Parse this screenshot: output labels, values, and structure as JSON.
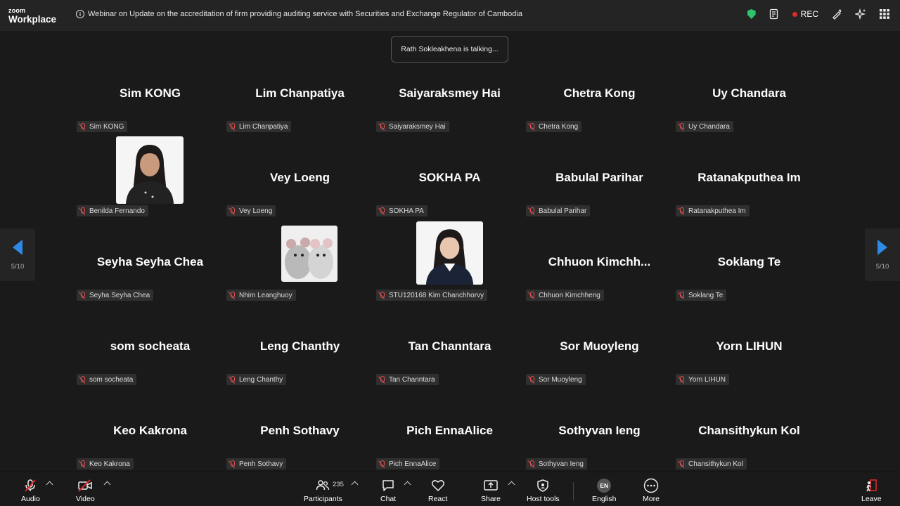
{
  "app": {
    "logo_top": "zoom",
    "logo_bottom": "Workplace"
  },
  "meeting": {
    "title": "Webinar on Update on the accreditation of firm providing auditing service with Securities and Exchange Regulator of Cambodia"
  },
  "topbar": {
    "rec_label": "REC",
    "rec_color": "#e02828",
    "shield_color": "#2dc26b"
  },
  "toast": {
    "text": "Rath Sokleakhena is talking..."
  },
  "pager": {
    "left": "5/10",
    "right": "5/10",
    "arrow_color": "#2e8ae6"
  },
  "participants": [
    {
      "display": "Sim KONG",
      "tag": "Sim KONG"
    },
    {
      "display": "Lim Chanpatiya",
      "tag": "Lim Chanpatiya"
    },
    {
      "display": "Saiyaraksmey Hai",
      "tag": "Saiyaraksmey Hai"
    },
    {
      "display": "Chetra Kong",
      "tag": "Chetra Kong"
    },
    {
      "display": "Uy Chandara",
      "tag": "Uy Chandara"
    },
    {
      "display": "",
      "tag": "Benilda Fernando"
    },
    {
      "display": "Vey Loeng",
      "tag": "Vey Loeng"
    },
    {
      "display": "SOKHA PA",
      "tag": "SOKHA PA"
    },
    {
      "display": "Babulal Parihar",
      "tag": "Babulal Parihar"
    },
    {
      "display": "Ratanakputhea Im",
      "tag": "Ratanakputhea Im"
    },
    {
      "display": "Seyha Seyha Chea",
      "tag": "Seyha Seyha Chea"
    },
    {
      "display": "",
      "tag": "Nhim Leanghuoy"
    },
    {
      "display": "",
      "tag": "STU120168 Kim Chanchhorvy"
    },
    {
      "display": "Chhuon  Kimchh...",
      "tag": "Chhuon Kimchheng"
    },
    {
      "display": "Soklang Te",
      "tag": "Soklang Te"
    },
    {
      "display": "som socheata",
      "tag": "som socheata"
    },
    {
      "display": "Leng Chanthy",
      "tag": "Leng Chanthy"
    },
    {
      "display": "Tan Channtara",
      "tag": "Tan Channtara"
    },
    {
      "display": "Sor Muoyleng",
      "tag": "Sor Muoyleng"
    },
    {
      "display": "Yorn LIHUN",
      "tag": "Yorn LIHUN"
    },
    {
      "display": "Keo Kakrona",
      "tag": "Keo Kakrona"
    },
    {
      "display": "Penh Sothavy",
      "tag": "Penh Sothavy"
    },
    {
      "display": "Pich EnnaAlice",
      "tag": "Pich EnnaAlice"
    },
    {
      "display": "Sothyvan Ieng",
      "tag": "Sothyvan Ieng"
    },
    {
      "display": "Chansithykun Kol",
      "tag": "Chansithykun Kol"
    }
  ],
  "toolbar": {
    "audio": "Audio",
    "video": "Video",
    "participants": "Participants",
    "participants_count": "235",
    "chat": "Chat",
    "react": "React",
    "share": "Share",
    "host_tools": "Host tools",
    "language": "English",
    "language_code": "EN",
    "more": "More",
    "leave": "Leave",
    "leave_color": "#e02828"
  }
}
